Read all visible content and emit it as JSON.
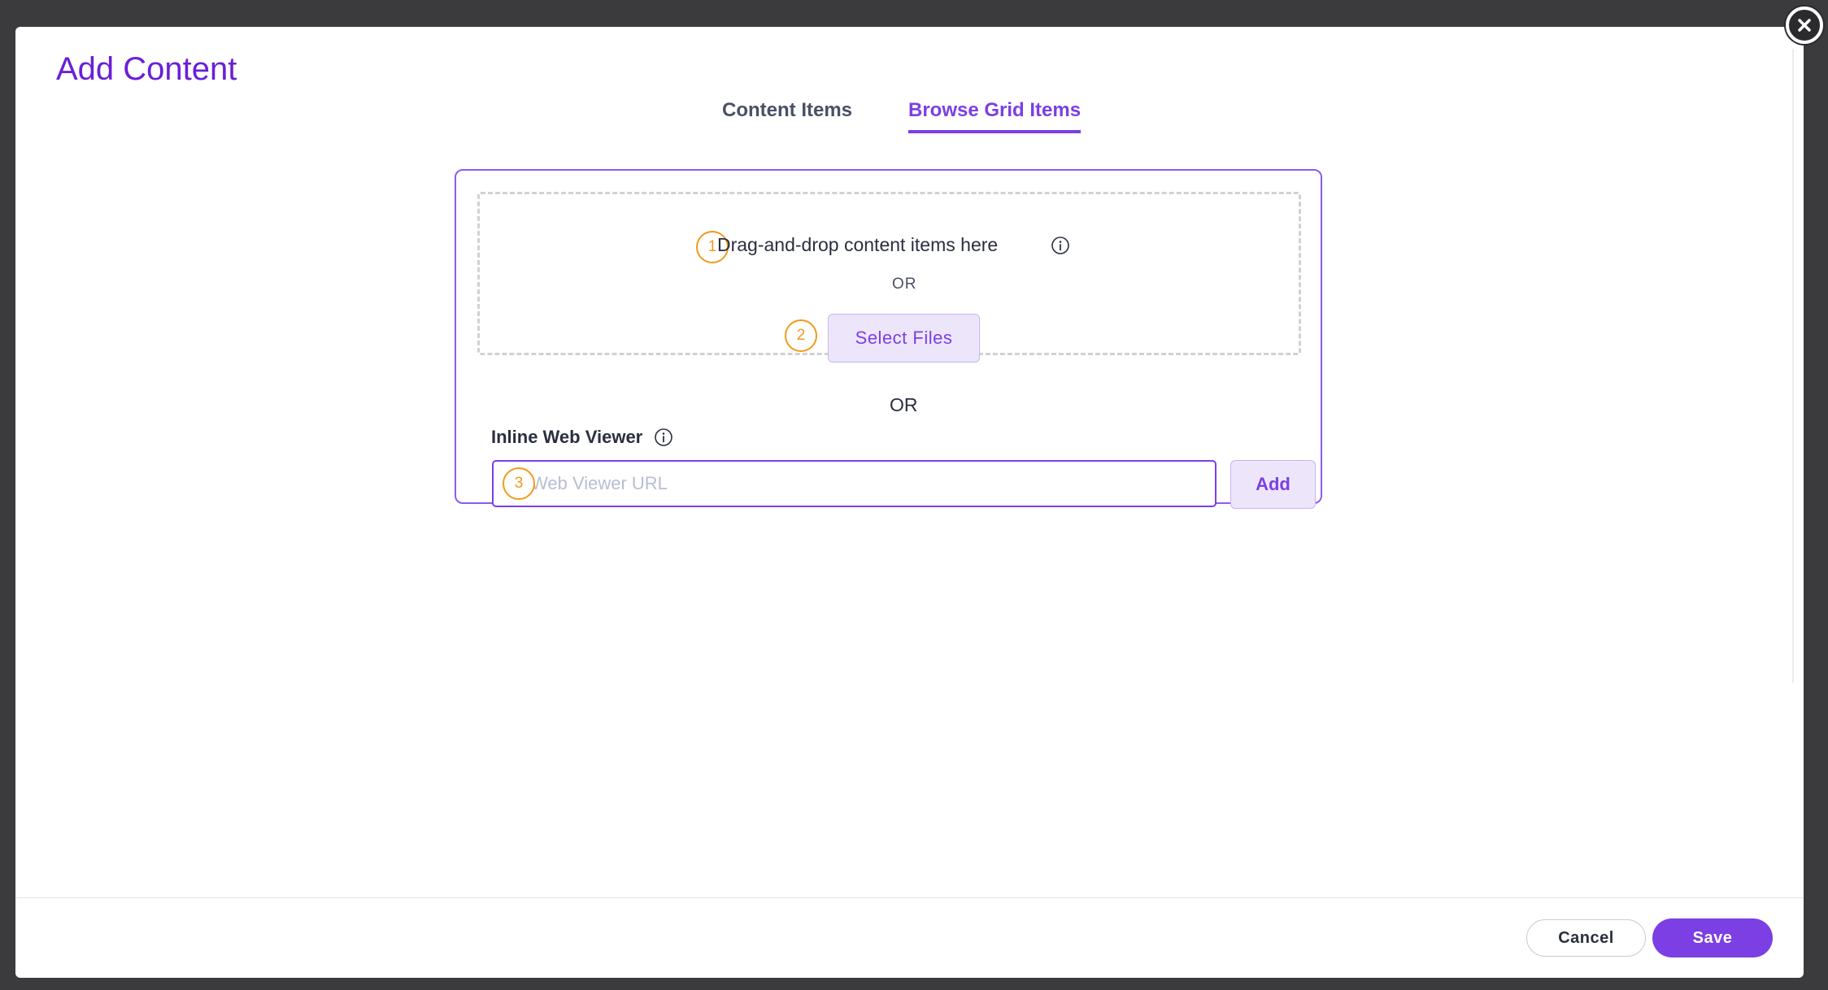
{
  "modal": {
    "title": "Add Content",
    "close_icon": "close-icon"
  },
  "tabs": [
    {
      "label": "Content Items",
      "active": false
    },
    {
      "label": "Browse Grid Items",
      "active": true
    }
  ],
  "dropzone": {
    "step1": "1",
    "instruction": "Drag-and-drop content items here",
    "info_icon": "info-icon",
    "or_label": "OR",
    "step2": "2",
    "select_button": "Select Files"
  },
  "separator": {
    "or_label": "OR"
  },
  "web_viewer": {
    "label": "Inline Web Viewer",
    "info_icon": "info-icon",
    "step3": "3",
    "placeholder": "Web Viewer URL",
    "value": "",
    "add_button": "Add"
  },
  "footer": {
    "cancel": "Cancel",
    "save": "Save"
  },
  "colors": {
    "accent": "#7b3fe4",
    "title": "#6a1fd6",
    "step_marker": "#f29a1b",
    "backdrop": "#3b3b3d"
  }
}
